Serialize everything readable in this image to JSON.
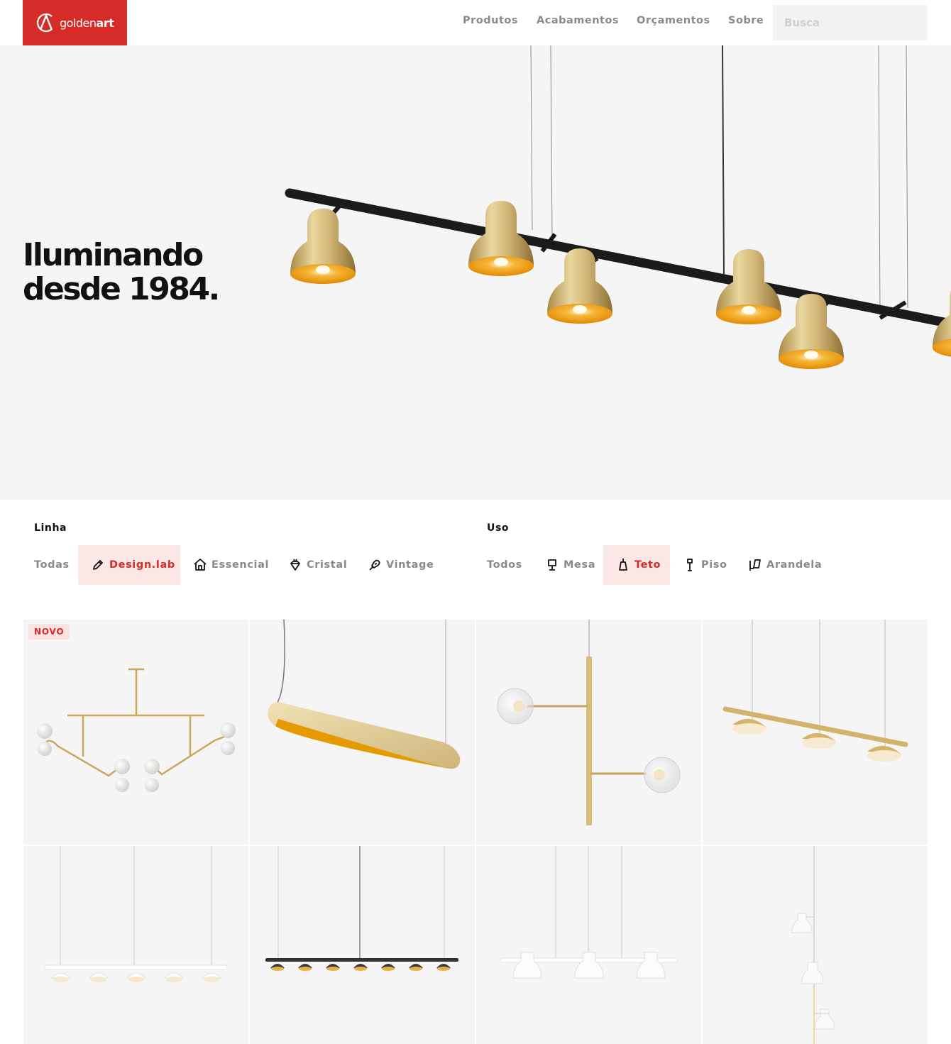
{
  "header": {
    "logo_text_light": "golden",
    "logo_text_bold": "art",
    "nav": [
      "Produtos",
      "Acabamentos",
      "Orçamentos",
      "Sobre"
    ],
    "search_placeholder": "Busca"
  },
  "hero": {
    "title_line1": "Iluminando",
    "title_line2": "desde 1984."
  },
  "filters": {
    "linha": {
      "label": "Linha",
      "items": [
        {
          "label": "Todas",
          "icon": null,
          "active": false
        },
        {
          "label": "Design.lab",
          "icon": "pencil-icon",
          "active": true
        },
        {
          "label": "Essencial",
          "icon": "house-icon",
          "active": false
        },
        {
          "label": "Cristal",
          "icon": "diamond-icon",
          "active": false
        },
        {
          "label": "Vintage",
          "icon": "bulb-filament-icon",
          "active": false
        }
      ]
    },
    "uso": {
      "label": "Uso",
      "items": [
        {
          "label": "Todos",
          "icon": null,
          "active": false
        },
        {
          "label": "Mesa",
          "icon": "table-lamp-icon",
          "active": false
        },
        {
          "label": "Teto",
          "icon": "ceiling-lamp-icon",
          "active": true
        },
        {
          "label": "Piso",
          "icon": "floor-lamp-icon",
          "active": false
        },
        {
          "label": "Arandela",
          "icon": "wall-lamp-icon",
          "active": false
        }
      ]
    }
  },
  "products": [
    {
      "badge": "NOVO",
      "image": "gold-chandelier-with-white-globes"
    },
    {
      "badge": null,
      "image": "gold-linear-pendant"
    },
    {
      "badge": null,
      "image": "gold-vertical-pendant-with-glass-bulbs"
    },
    {
      "badge": null,
      "image": "gold-bar-with-three-domes"
    },
    {
      "badge": null,
      "image": "white-bar-with-five-domes"
    },
    {
      "badge": null,
      "image": "black-bar-with-seven-domes"
    },
    {
      "badge": null,
      "image": "white-bar-with-three-shades"
    },
    {
      "badge": null,
      "image": "white-vertical-cascade-pendant"
    }
  ],
  "colors": {
    "brand_red": "#d62b27",
    "active_bg": "#fbe7e6",
    "gold": "#d9b974",
    "gold_inner": "#f0a010"
  }
}
